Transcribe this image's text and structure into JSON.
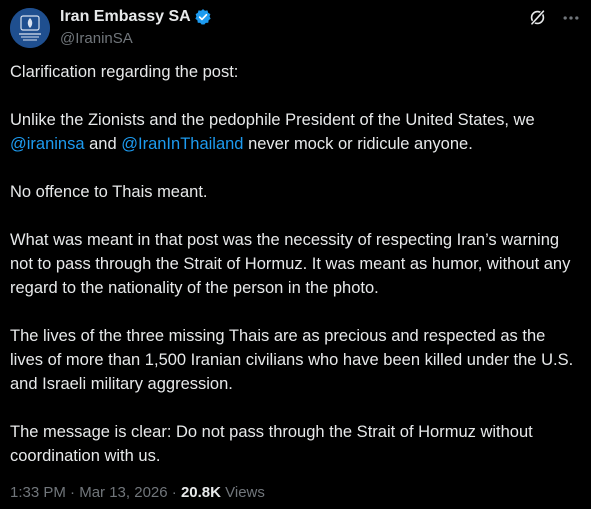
{
  "account": {
    "display_name": "Iran Embassy SA",
    "handle": "@IraninSA",
    "avatar_icon": "emblem-icon",
    "verified_color": "#1d9bf0"
  },
  "actions": {
    "grok_icon": "grok-icon",
    "more_icon": "more-icon"
  },
  "post": {
    "p1": "Clarification regarding the post:",
    "p2_a": "Unlike the Zionists and the pedophile President of the United States, we ",
    "mention1": "@iraninsa",
    "p2_b": " and ",
    "mention2": "@IranInThailand",
    "p2_c": " never mock or ridicule anyone.",
    "p3": "No offence to Thais meant.",
    "p4": "What was meant in that post was the necessity of respecting Iran’s warning not to pass through the Strait of Hormuz. It was meant as humor, without any regard to the nationality of the person in the photo.",
    "p5": "The lives of the three missing Thais are as precious and respected as the lives of more than 1,500 Iranian civilians who have been killed under the U.S. and Israeli military aggression.",
    "p6": "The message is clear: Do not pass through the Strait of Hormuz without coordination with us."
  },
  "meta": {
    "time": "1:33 PM",
    "separator": " · ",
    "date": "Mar 13, 2026",
    "views_count": "20.8K",
    "views_label": " Views"
  },
  "colors": {
    "background": "#000000",
    "text": "#e7e9ea",
    "secondary": "#71767b",
    "link": "#1d9bf0"
  }
}
